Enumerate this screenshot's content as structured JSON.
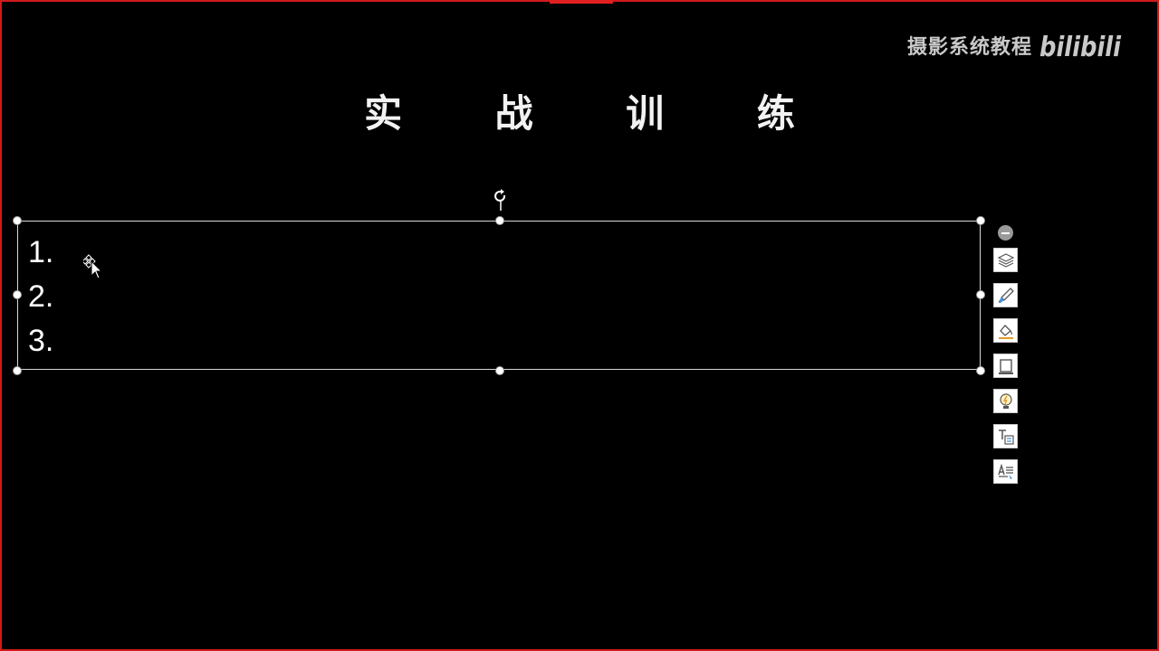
{
  "watermark": {
    "text": "摄影系统教程",
    "logo": "bilibili"
  },
  "slide": {
    "title": "实 战 训 练",
    "list_items": [
      "1.",
      "2.",
      "3."
    ]
  },
  "colors": {
    "background": "#000000",
    "frame": "#d11a1a",
    "text": "#ffffff"
  },
  "toolbar": {
    "buttons": [
      {
        "icon": "layers-icon"
      },
      {
        "icon": "style-brush-icon"
      },
      {
        "icon": "shape-fill-icon"
      },
      {
        "icon": "shape-outline-icon"
      },
      {
        "icon": "design-ideas-lightbulb-icon"
      },
      {
        "icon": "text-box-icon"
      },
      {
        "icon": "text-style-icon"
      }
    ]
  }
}
